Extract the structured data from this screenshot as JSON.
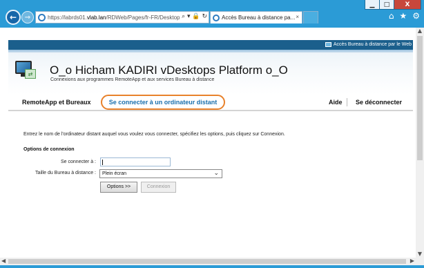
{
  "browser": {
    "url_prefix": "https://labrds01.",
    "url_domain": "vlab.lan",
    "url_path": "/RDWeb/Pages/fr-FR/Desktops",
    "address_tools": "⌕ ▾ 🔒 ↻",
    "tab_title": "Accès Bureau à distance pa...",
    "tab_close": "×",
    "window_buttons": {
      "minimize": "▁",
      "maximize": "□",
      "close": "X"
    },
    "icons": {
      "back": "back-arrow-icon",
      "forward": "forward-arrow-icon",
      "home": "home-icon",
      "favorites": "star-icon",
      "settings": "gear-icon"
    }
  },
  "page": {
    "top_link": "Accès Bureau à distance par le Web",
    "title": "O_o Hicham KADIRI vDesktops Platform o_O",
    "subtitle": "Connexions aux programmes RemoteApp et aux services Bureau à distance",
    "nav": {
      "remoteapp": "RemoteApp et Bureaux",
      "connect": "Se connecter à un ordinateur distant",
      "help": "Aide",
      "logout": "Se déconnecter"
    },
    "instructions": "Entrez le nom de l'ordinateur distant auquel vous voulez vous connecter, spécifiez les options, puis cliquez sur Connexion.",
    "options_heading": "Options de connexion",
    "connect_label": "Se connecter à :",
    "connect_value": "",
    "size_label": "Taille du Bureau à distance :",
    "size_value": "Plein écran",
    "options_button": "Options >>",
    "connexion_button": "Connexion"
  }
}
